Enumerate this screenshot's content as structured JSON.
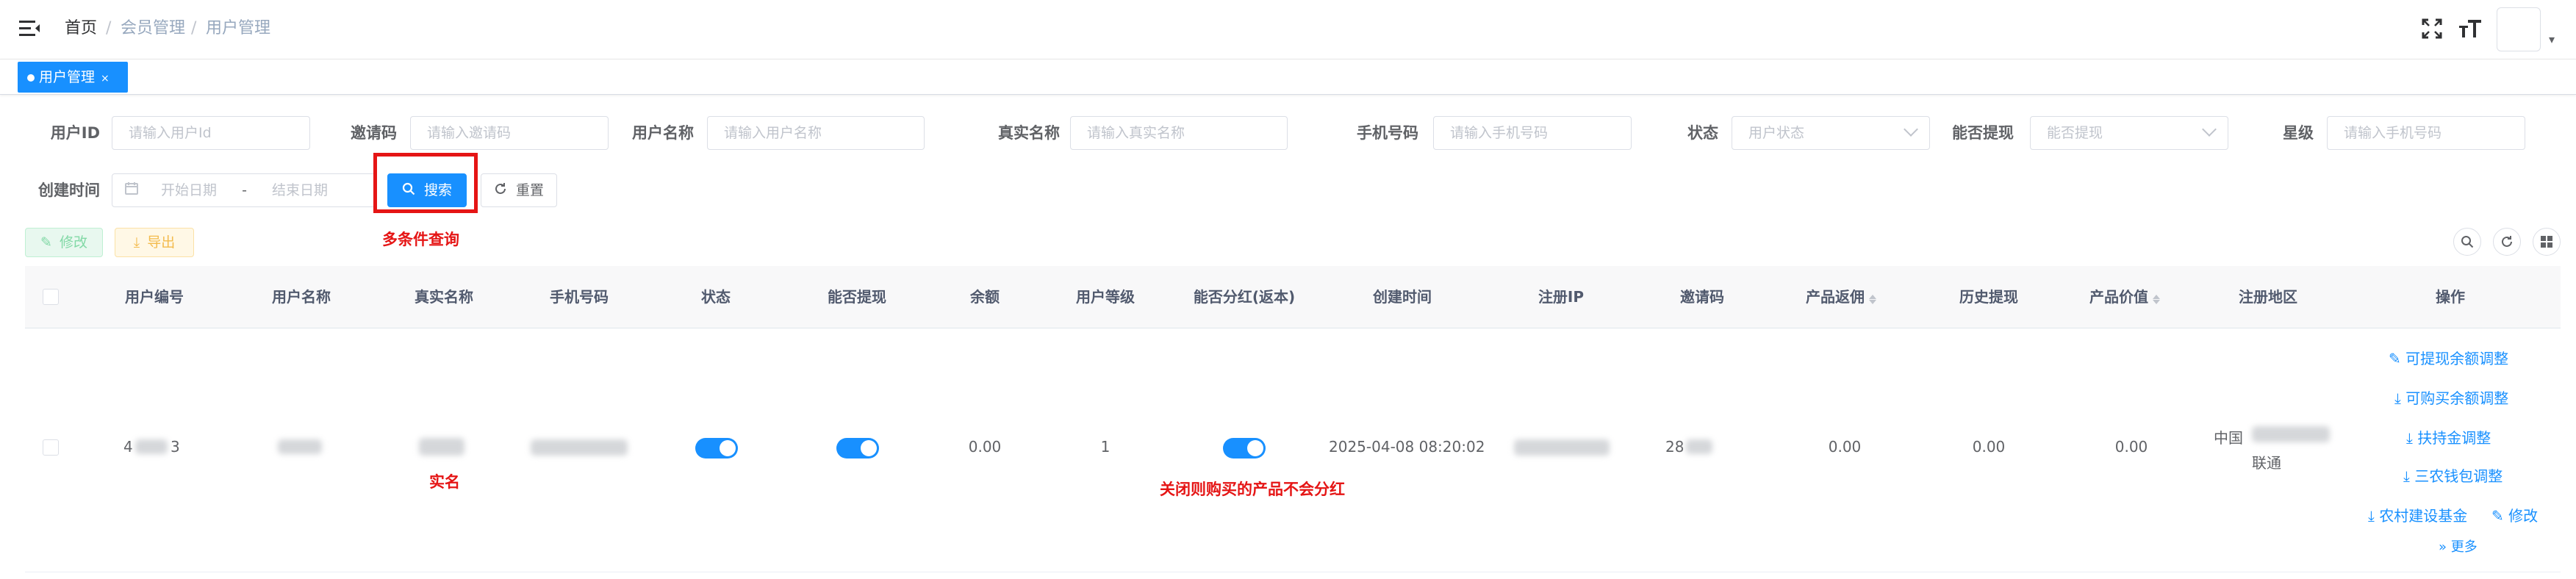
{
  "breadcrumb": {
    "home": "首页",
    "sep": "/",
    "members": "会员管理",
    "users": "用户管理"
  },
  "tags": {
    "active": "用户管理",
    "close": "×"
  },
  "search": {
    "user_id": {
      "label": "用户ID",
      "placeholder": "请输入用户Id"
    },
    "invite_code": {
      "label": "邀请码",
      "placeholder": "请输入邀请码"
    },
    "user_name": {
      "label": "用户名称",
      "placeholder": "请输入用户名称"
    },
    "real_name": {
      "label": "真实名称",
      "placeholder": "请输入真实名称"
    },
    "phone": {
      "label": "手机号码",
      "placeholder": "请输入手机号码"
    },
    "status": {
      "label": "状态",
      "placeholder": "用户状态"
    },
    "withdraw": {
      "label": "能否提现",
      "placeholder": "能否提现"
    },
    "star": {
      "label": "星级",
      "placeholder": "请输入手机号码"
    },
    "created": {
      "label": "创建时间",
      "start": "开始日期",
      "dash": "-",
      "end": "结束日期"
    },
    "search_btn": "搜索",
    "reset_btn": "重置"
  },
  "toolbar": {
    "edit": "修改",
    "export": "导出"
  },
  "annotations": {
    "multi_search": "多条件查询",
    "real_name": "实名",
    "dividend_note": "关闭则购买的产品不会分红"
  },
  "table": {
    "headers": [
      "用户编号",
      "用户名称",
      "真实名称",
      "手机号码",
      "状态",
      "能否提现",
      "余额",
      "用户等级",
      "能否分红(返本)",
      "创建时间",
      "注册IP",
      "邀请码",
      "产品返佣",
      "历史提现",
      "产品价值",
      "注册地区",
      "操作"
    ],
    "row": {
      "user_no_a": "4",
      "user_no_b": "3",
      "balance": "0.00",
      "level": "1",
      "created": "2025-04-08 08:20:02",
      "invite": "28",
      "commission": "0.00",
      "history": "0.00",
      "value": "0.00",
      "region_a": "中国",
      "region_b": "联通",
      "status_on": true,
      "withdraw_on": true,
      "dividend_on": true
    },
    "actions": {
      "withdrawable": "可提现余额调整",
      "purchasable": "可购买余额调整",
      "support": "扶持金调整",
      "rural_wallet": "三农钱包调整",
      "rural_fund": "农村建设基金",
      "edit": "修改",
      "more": "更多"
    }
  },
  "colors": {
    "primary": "#1890ff",
    "annotation_red": "#e51515"
  }
}
